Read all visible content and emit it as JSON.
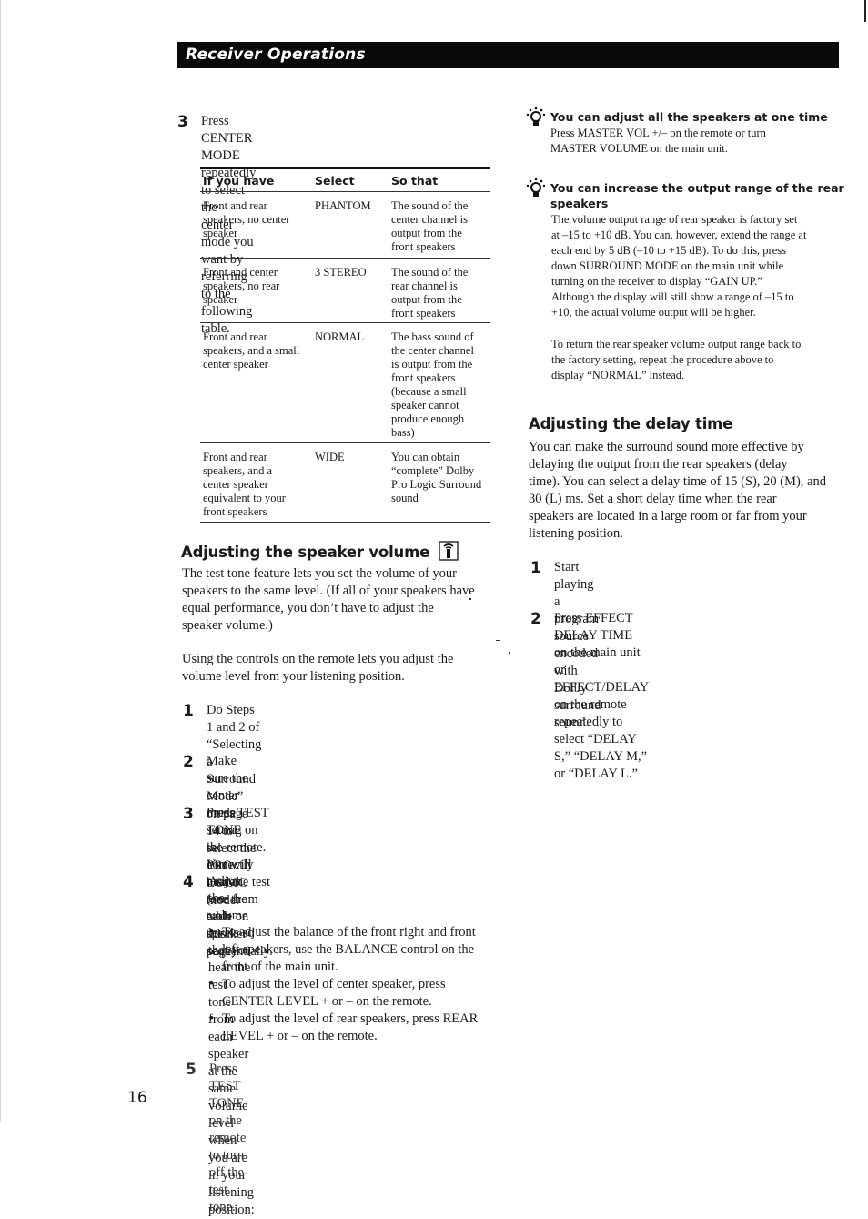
{
  "header": {
    "section_title": "Receiver Operations"
  },
  "center_mode": {
    "step_number": "3",
    "step_text": "Press CENTER MODE repeatedly to select the\ncenter mode you want by referring to the\nfollowing table.",
    "table": {
      "columns": [
        "If you have",
        "Select",
        "So that"
      ],
      "rows": [
        {
          "have": "Front and rear\nspeakers, no center\nspeaker",
          "select": "PHANTOM",
          "result": "The sound of the\ncenter channel is\noutput from the\nfront speakers"
        },
        {
          "have": "Front and center\nspeakers, no rear\nspeaker",
          "select": "3 STEREO",
          "result": "The sound of the\nrear channel is\noutput from the\nfront speakers"
        },
        {
          "have": "Front and rear\nspeakers, and a small\ncenter speaker",
          "select": "NORMAL",
          "result": "The bass sound of\nthe center channel\nis output from the\nfront speakers\n(because a small\nspeaker cannot\nproduce enough\nbass)"
        },
        {
          "have": "Front and rear\nspeakers, and a\ncenter speaker\nequivalent to your\nfront speakers",
          "select": "WIDE",
          "result": "You can obtain\n“complete” Dolby\nPro Logic Surround\nsound"
        }
      ]
    }
  },
  "speaker_volume": {
    "title": "Adjusting the speaker volume",
    "title_icon": "remote-control-icon",
    "intro": "The test tone feature lets you set the volume of your\nspeakers to the same level.  (If all of your speakers have\nequal performance, you don’t have to adjust the\nspeaker volume.)",
    "intro2": "Using the controls on the remote lets you adjust the\nvolume level from your listening position.",
    "steps": [
      {
        "num": "1",
        "text": "Do Steps 1 and 2 of “Selecting a Surround Mode”\non page 14 to select the PRO LOGIC mode."
      },
      {
        "num": "2",
        "text": "Make sure the center mode setting is correctly\nmade (see the table on this page)."
      },
      {
        "num": "3",
        "text": "Press TEST TONE on the remote.\nYou will hear the test tone from each speaker\nsequentially."
      },
      {
        "num": "4",
        "text": "Adjust the volume levels so that you hear the test\ntone from each speaker at the same volume level\nwhen you are in your listening position:"
      },
      {
        "num": "5",
        "text": "Press TEST TONE on the remote to turn off the\ntest tone."
      }
    ],
    "bullets": [
      "To adjust the balance of the front right and front\nleft speakers, use the BALANCE control on the\nfront of the main unit.",
      "To adjust the level of center speaker, press\nCENTER LEVEL + or – on the remote.",
      "To adjust the level of rear speakers, press REAR\nLEVEL + or – on the remote."
    ]
  },
  "tips": [
    {
      "icon": "lightbulb-tip-icon",
      "title": "You can adjust all the speakers at one time",
      "body": "Press MASTER VOL +/– on the remote or turn\nMASTER VOLUME on the main unit."
    },
    {
      "icon": "lightbulb-tip-icon",
      "title": "You can increase the output range of the rear\nspeakers",
      "body": "The volume output range of rear speaker is factory set\nat –15 to +10 dB.  You can, however, extend the range at\neach end by 5 dB (–10 to +15 dB).  To do this, press\ndown SURROUND MODE on the main unit while\nturning on the receiver to display “GAIN UP.”\nAlthough the display will still show a range of –15 to\n+10, the actual volume output will be higher.",
      "body2": "To return the rear speaker volume output range back to\nthe factory setting, repeat the procedure above to\ndisplay “NORMAL” instead."
    }
  ],
  "delay_time": {
    "title": "Adjusting the delay time",
    "intro": "You can make the surround sound more effective by\ndelaying the output from the rear speakers (delay\ntime).  You can select a delay time of 15 (S), 20 (M), and\n30 (L) ms.  Set a short delay time when the rear\nspeakers are located in a large room or far from your\nlistening position.",
    "steps": [
      {
        "num": "1",
        "text": "Start playing a program source encoded with\nDolby surround sound."
      },
      {
        "num": "2",
        "text": "Press EFFECT DELAY TIME on the main unit or\nEFFECT/DELAY on the remote repeatedly to\nselect “DELAY S,” “DELAY M,” or “DELAY L.”"
      }
    ]
  },
  "footer": {
    "page_number": "16"
  }
}
